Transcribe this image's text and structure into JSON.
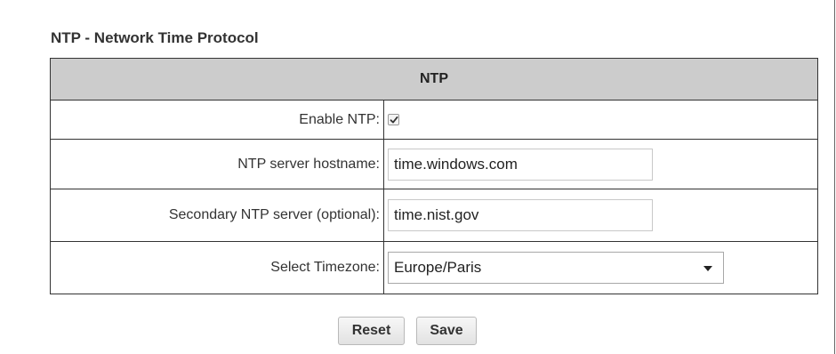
{
  "section": {
    "title": "NTP - Network Time Protocol"
  },
  "table": {
    "header": "NTP",
    "rows": {
      "enable": {
        "label": "Enable NTP:",
        "checked": true
      },
      "hostname": {
        "label": "NTP server hostname:",
        "value": "time.windows.com"
      },
      "secondary": {
        "label": "Secondary NTP server (optional):",
        "value": "time.nist.gov"
      },
      "timezone": {
        "label": "Select Timezone:",
        "selected": "Europe/Paris"
      }
    }
  },
  "buttons": {
    "reset_label": "Reset",
    "save_label": "Save"
  }
}
